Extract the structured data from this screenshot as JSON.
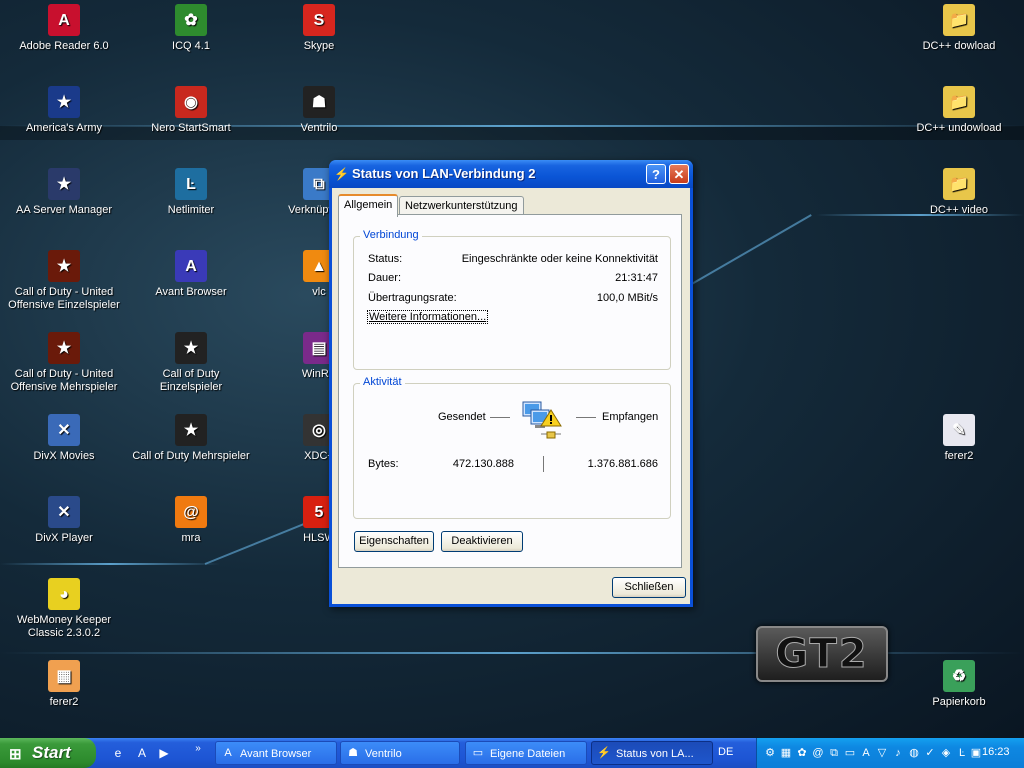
{
  "desktop": {
    "icons": [
      {
        "label": "Adobe Reader 6.0",
        "glyph": "A",
        "color": "#c8102e",
        "icon": "adobe-reader-icon"
      },
      {
        "label": "ICQ 4.1",
        "glyph": "✿",
        "color": "#2e8b2e",
        "icon": "icq-flower-icon"
      },
      {
        "label": "Skype",
        "glyph": "S",
        "color": "#d7261e",
        "icon": "skype-icon"
      },
      {
        "label": "DC++ dowload",
        "glyph": "📁",
        "color": "#e8c64a",
        "icon": "folder-icon"
      },
      {
        "label": "America's Army",
        "glyph": "★",
        "color": "#1a3a8a",
        "icon": "americas-army-icon"
      },
      {
        "label": "Nero StartSmart",
        "glyph": "◉",
        "color": "#c8281e",
        "icon": "nero-icon"
      },
      {
        "label": "Ventrilo",
        "glyph": "☗",
        "color": "#222222",
        "icon": "ventrilo-icon"
      },
      {
        "label": "DC++ undowload",
        "glyph": "📁",
        "color": "#e8c64a",
        "icon": "folder-icon"
      },
      {
        "label": "AA Server Manager",
        "glyph": "★",
        "color": "#2a3a6a",
        "icon": "aa-server-manager-icon"
      },
      {
        "label": "Netlimiter",
        "glyph": "Ŀ",
        "color": "#1e6ea0",
        "icon": "netlimiter-icon"
      },
      {
        "label": "Verknüpfung",
        "glyph": "⧉",
        "color": "#3a7ac8",
        "icon": "network-shortcut-icon"
      },
      {
        "label": "DC++ video",
        "glyph": "📁",
        "color": "#e8c64a",
        "icon": "folder-icon"
      },
      {
        "label": "Call of Duty - United Offensive Einzelspieler",
        "glyph": "★",
        "color": "#6a1a0a",
        "icon": "cod-uo-icon"
      },
      {
        "label": "Avant Browser",
        "glyph": "A",
        "color": "#3a3ab8",
        "icon": "avant-browser-icon"
      },
      {
        "label": "vlc",
        "glyph": "▲",
        "color": "#f08a10",
        "icon": "vlc-cone-icon"
      },
      {
        "label": "Call of Duty - United Offensive Mehrspieler",
        "glyph": "★",
        "color": "#6a1a0a",
        "icon": "cod-uo-mp-icon"
      },
      {
        "label": "Call of Duty Einzelspieler",
        "glyph": "★",
        "color": "#222222",
        "icon": "cod-icon"
      },
      {
        "label": "WinRA",
        "glyph": "▤",
        "color": "#7a2a8a",
        "icon": "winrar-icon"
      },
      {
        "label": "DivX Movies",
        "glyph": "✕",
        "color": "#3a6ab8",
        "icon": "divx-movies-icon"
      },
      {
        "label": "Call of Duty Mehrspieler",
        "glyph": "★",
        "color": "#222222",
        "icon": "cod-mp-icon"
      },
      {
        "label": "XDC+",
        "glyph": "◎",
        "color": "#333333",
        "icon": "xdc-icon"
      },
      {
        "label": "ferer2",
        "glyph": "✎",
        "color": "#e8e8f0",
        "icon": "document-icon"
      },
      {
        "label": "DivX Player",
        "glyph": "✕",
        "color": "#2a4a8a",
        "icon": "divx-player-icon"
      },
      {
        "label": "mra",
        "glyph": "@",
        "color": "#f07a10",
        "icon": "mail-agent-icon"
      },
      {
        "label": "HLSW",
        "glyph": "5",
        "color": "#d82010",
        "icon": "hlsw-icon"
      },
      {
        "label": "WebMoney Keeper Classic 2.3.0.2",
        "glyph": "◕",
        "color": "#e8d020",
        "icon": "webmoney-icon"
      },
      {
        "label": "ferer2",
        "glyph": "▦",
        "color": "#f0a050",
        "icon": "document-icon"
      },
      {
        "label": "Papierkorb",
        "glyph": "♻",
        "color": "#3aa05a",
        "icon": "recycle-bin-icon"
      }
    ],
    "logo_text": "GT2"
  },
  "dialog": {
    "title": "Status von LAN-Verbindung 2",
    "help_glyph": "?",
    "close_glyph": "✕",
    "tabs": [
      "Allgemein",
      "Netzwerkunterstützung"
    ],
    "connection": {
      "legend": "Verbindung",
      "rows": [
        {
          "label": "Status:",
          "value": "Eingeschränkte oder keine Konnektivität"
        },
        {
          "label": "Dauer:",
          "value": "21:31:47"
        },
        {
          "label": "Übertragungsrate:",
          "value": "100,0 MBit/s"
        }
      ],
      "more_info": "Weitere Informationen..."
    },
    "activity": {
      "legend": "Aktivität",
      "sent_label": "Gesendet",
      "received_label": "Empfangen",
      "bytes_label": "Bytes:",
      "bytes_sent": "472.130.888",
      "bytes_received": "1.376.881.686"
    },
    "buttons": {
      "properties": "Eigenschaften",
      "disable": "Deaktivieren",
      "close": "Schließen"
    }
  },
  "taskbar": {
    "start": "Start",
    "tasks": [
      "Avant Browser",
      "Ventrilo",
      "Eigene Dateien",
      "Status von LA..."
    ],
    "language": "DE",
    "clock": "16:23"
  }
}
